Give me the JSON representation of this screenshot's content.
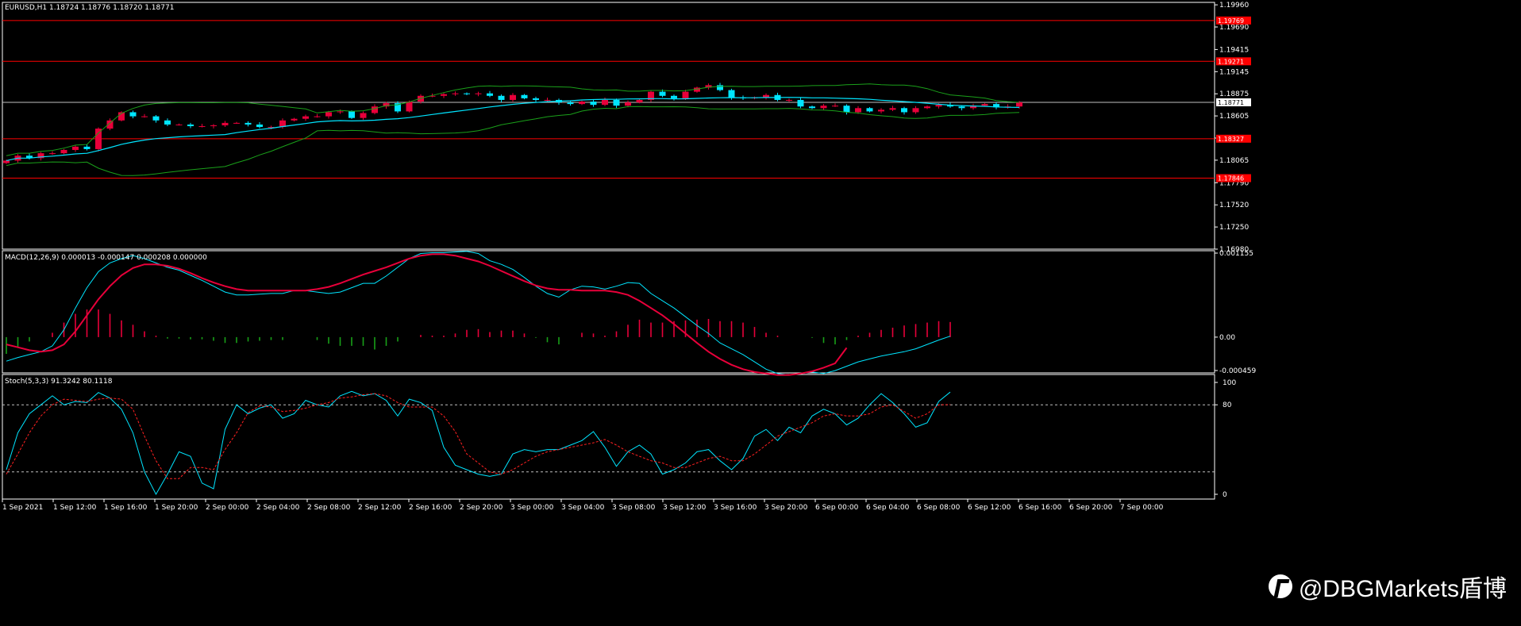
{
  "chart_data": [
    {
      "type": "candlestick",
      "panel": "price",
      "label": "EURUSD,H1  1.18724 1.18776 1.18720 1.18771",
      "ylim": [
        1.1698,
        1.1999
      ],
      "y_ticks": [
        "1.19960",
        "1.19690",
        "1.19415",
        "1.19145",
        "1.18875",
        "1.18605",
        "1.18335",
        "1.18065",
        "1.17790",
        "1.17520",
        "1.17250",
        "1.16980"
      ],
      "current_price": "1.18771",
      "horizontal_levels": [
        {
          "label": "1.19769",
          "value": 1.19769
        },
        {
          "label": "1.19271",
          "value": 1.19271
        },
        {
          "label": "1.18327",
          "value": 1.18327
        },
        {
          "label": "1.17846",
          "value": 1.17846
        }
      ],
      "closes": [
        1.1806,
        1.1812,
        1.1809,
        1.1815,
        1.1815,
        1.1819,
        1.1823,
        1.182,
        1.1845,
        1.1855,
        1.1865,
        1.186,
        1.186,
        1.1855,
        1.185,
        1.185,
        1.1848,
        1.1848,
        1.1849,
        1.1852,
        1.1852,
        1.185,
        1.1847,
        1.1847,
        1.1855,
        1.1857,
        1.186,
        1.186,
        1.1865,
        1.1866,
        1.1858,
        1.1864,
        1.1872,
        1.1876,
        1.1866,
        1.1878,
        1.1885,
        1.1885,
        1.1887,
        1.1888,
        1.1887,
        1.1888,
        1.1885,
        1.188,
        1.1886,
        1.1882,
        1.188,
        1.188,
        1.1877,
        1.1875,
        1.1878,
        1.1874,
        1.188,
        1.1873,
        1.1877,
        1.188,
        1.189,
        1.1885,
        1.1882,
        1.189,
        1.1895,
        1.1898,
        1.1892,
        1.1883,
        1.1882,
        1.1883,
        1.1886,
        1.188,
        1.188,
        1.1872,
        1.187,
        1.1873,
        1.1873,
        1.1865,
        1.187,
        1.1866,
        1.1868,
        1.187,
        1.1865,
        1.187,
        1.1872,
        1.1874,
        1.1872,
        1.187,
        1.1873,
        1.1875,
        1.1871,
        1.1872,
        1.18771
      ],
      "x_tick_labels": [
        "1 Sep 2021",
        "1 Sep 12:00",
        "1 Sep 16:00",
        "1 Sep 20:00",
        "2 Sep 00:00",
        "2 Sep 04:00",
        "2 Sep 08:00",
        "2 Sep 12:00",
        "2 Sep 16:00",
        "2 Sep 20:00",
        "3 Sep 00:00",
        "3 Sep 04:00",
        "3 Sep 08:00",
        "3 Sep 12:00",
        "3 Sep 16:00",
        "3 Sep 20:00",
        "6 Sep 00:00",
        "6 Sep 04:00",
        "6 Sep 08:00",
        "6 Sep 12:00",
        "6 Sep 16:00",
        "6 Sep 20:00",
        "7 Sep 00:00"
      ],
      "overlays": [
        "Bollinger Bands (green)",
        "Moving Average (cyan)"
      ]
    },
    {
      "type": "line",
      "panel": "macd",
      "label": "MACD(12,26,9) 0.000013 -0.000147 0.000208 0.000000",
      "ylim": [
        -0.000459,
        0.001155
      ],
      "y_ticks": [
        "0.001155",
        "0.00",
        "-0.000459"
      ],
      "macd_line": [
        -0.00033,
        -0.00028,
        -0.00024,
        -0.0002,
        -0.00012,
        0.0001,
        0.0004,
        0.00068,
        0.0009,
        0.00102,
        0.00108,
        0.00112,
        0.00108,
        0.00102,
        0.00096,
        0.00092,
        0.00085,
        0.00078,
        0.0007,
        0.00062,
        0.00058,
        0.00058,
        0.00059,
        0.0006,
        0.0006,
        0.00064,
        0.00064,
        0.00062,
        0.0006,
        0.00062,
        0.00068,
        0.00074,
        0.00074,
        0.00084,
        0.00096,
        0.00108,
        0.00115,
        0.00116,
        0.00116,
        0.00117,
        0.00118,
        0.00115,
        0.00105,
        0.001,
        0.00093,
        0.00082,
        0.0007,
        0.0006,
        0.00055,
        0.00065,
        0.0007,
        0.00069,
        0.00066,
        0.0007,
        0.00075,
        0.00074,
        0.0006,
        0.0005,
        0.0004,
        0.00028,
        0.00016,
        5e-05,
        -8e-05,
        -0.00016,
        -0.00024,
        -0.00034,
        -0.00044,
        -0.0005,
        -0.00052,
        -0.0005,
        -0.00048,
        -0.0005,
        -0.00046,
        -0.0004,
        -0.00034,
        -0.0003,
        -0.00026,
        -0.00023,
        -0.0002,
        -0.00016,
        -0.0001,
        -4e-05,
        1.3e-05
      ],
      "signal_line": [
        -0.0001,
        -0.00014,
        -0.00018,
        -0.0002,
        -0.00018,
        -0.0001,
        8e-05,
        0.0003,
        0.00052,
        0.0007,
        0.00085,
        0.00095,
        0.001,
        0.001,
        0.00098,
        0.00094,
        0.00088,
        0.00081,
        0.00075,
        0.0007,
        0.00066,
        0.00064,
        0.00064,
        0.00064,
        0.00064,
        0.00064,
        0.00064,
        0.00066,
        0.00069,
        0.00074,
        0.0008,
        0.00086,
        0.00091,
        0.00096,
        0.00102,
        0.00108,
        0.00112,
        0.00114,
        0.00114,
        0.00112,
        0.00108,
        0.00104,
        0.00098,
        0.00091,
        0.00084,
        0.00077,
        0.00071,
        0.00067,
        0.00065,
        0.00065,
        0.00064,
        0.00064,
        0.00064,
        0.00062,
        0.00058,
        0.0005,
        0.0004,
        0.0003,
        0.00018,
        5e-05,
        -8e-05,
        -0.0002,
        -0.0003,
        -0.00038,
        -0.00044,
        -0.00048,
        -0.0005,
        -0.00052,
        -0.00052,
        -0.0005,
        -0.00047,
        -0.00042,
        -0.00036,
        -0.000147
      ],
      "histogram": [
        -0.00023,
        -0.00014,
        -6e-05,
        0.0,
        6e-05,
        0.0002,
        0.00032,
        0.00038,
        0.00038,
        0.00032,
        0.00023,
        0.00017,
        8e-05,
        2e-05,
        -2e-05,
        -2e-05,
        -3e-05,
        -3e-05,
        -5e-05,
        -8e-05,
        -8e-05,
        -6e-05,
        -5e-05,
        -4e-05,
        -4e-05,
        0.0,
        0.0,
        -4e-05,
        -9e-05,
        -0.00012,
        -0.00012,
        -0.00012,
        -0.00017,
        -0.00012,
        -6e-05,
        0.0,
        3e-05,
        2e-05,
        2e-05,
        5e-05,
        0.0001,
        0.00011,
        7e-05,
        9e-05,
        9e-05,
        5e-05,
        -1e-05,
        -7e-05,
        -0.0001,
        0.0,
        6e-05,
        5e-05,
        2e-05,
        8e-05,
        0.00017,
        0.00024,
        0.0002,
        0.0002,
        0.00022,
        0.00023,
        0.00024,
        0.00025,
        0.00022,
        0.00022,
        0.0002,
        0.00014,
        6e-05,
        2e-05,
        0.0,
        0.0,
        -1e-05,
        -8e-05,
        -0.0001,
        -4e-05,
        2e-05,
        6e-05,
        0.0001,
        0.00013,
        0.00016,
        0.00018,
        0.0002,
        0.00022,
        0.000208
      ]
    },
    {
      "type": "line",
      "panel": "stochastic",
      "label": "Stoch(5,3,3) 91.3242 80.1118",
      "ylim": [
        0,
        100
      ],
      "y_ticks": [
        "100",
        "80",
        "0"
      ],
      "levels": [
        80,
        20
      ],
      "main_line": [
        22,
        55,
        72,
        80,
        88,
        80,
        83,
        82,
        91,
        86,
        76,
        55,
        20,
        0,
        18,
        38,
        34,
        10,
        5,
        58,
        80,
        72,
        77,
        80,
        68,
        72,
        84,
        80,
        78,
        88,
        92,
        88,
        90,
        84,
        70,
        85,
        82,
        75,
        42,
        26,
        22,
        18,
        16,
        18,
        36,
        40,
        38,
        40,
        40,
        44,
        48,
        56,
        42,
        25,
        38,
        44,
        36,
        18,
        22,
        28,
        38,
        40,
        30,
        22,
        32,
        52,
        58,
        48,
        60,
        55,
        70,
        76,
        72,
        62,
        68,
        80,
        90,
        82,
        72,
        60,
        64,
        83,
        91.3242
      ],
      "signal_line": [
        18,
        36,
        55,
        70,
        80,
        85,
        84,
        83,
        85,
        86,
        85,
        76,
        52,
        30,
        14,
        14,
        24,
        24,
        22,
        40,
        55,
        73,
        79,
        78,
        74,
        75,
        77,
        80,
        82,
        86,
        87,
        89,
        90,
        88,
        82,
        78,
        78,
        78,
        70,
        56,
        36,
        28,
        20,
        18,
        22,
        28,
        34,
        38,
        40,
        42,
        44,
        46,
        49,
        44,
        38,
        34,
        30,
        28,
        24,
        24,
        28,
        32,
        34,
        30,
        30,
        36,
        44,
        52,
        56,
        60,
        64,
        70,
        72,
        70,
        70,
        72,
        78,
        80,
        74,
        68,
        72,
        80,
        80.1118
      ]
    }
  ],
  "watermark_text": "@DBGMarkets盾博"
}
